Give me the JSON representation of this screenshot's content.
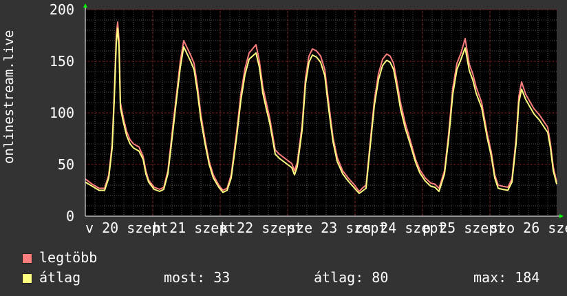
{
  "chart_data": {
    "type": "line",
    "ylabel": "onlinestream.live",
    "ylim": [
      0,
      200
    ],
    "yticks": [
      0,
      50,
      100,
      150,
      200
    ],
    "xlim": [
      0,
      685
    ],
    "xticks": [
      {
        "label": "v 20 szept",
        "x": 0
      },
      {
        "label": "h 21 szept",
        "x": 98
      },
      {
        "label": "k 22 szept",
        "x": 196
      },
      {
        "label": "sze 23 szept",
        "x": 294
      },
      {
        "label": "cs 24 szept",
        "x": 392
      },
      {
        "label": "p 25 szept",
        "x": 490
      },
      {
        "label": "szo 26 szept",
        "x": 588
      }
    ],
    "grid": true,
    "colors": {
      "background": "#333333",
      "plot": "#000000",
      "grid_major": "#8b1e1e",
      "grid_minor": "#555555",
      "axis": "#ffffff",
      "arrow": "#00ff00"
    },
    "series": [
      {
        "name": "legtöbb",
        "color": "#ff7f7f",
        "points": [
          [
            0,
            36
          ],
          [
            10,
            31
          ],
          [
            20,
            27
          ],
          [
            28,
            27
          ],
          [
            34,
            40
          ],
          [
            39,
            70
          ],
          [
            42,
            118
          ],
          [
            45,
            175
          ],
          [
            47,
            188
          ],
          [
            49,
            170
          ],
          [
            51,
            110
          ],
          [
            55,
            96
          ],
          [
            60,
            82
          ],
          [
            65,
            74
          ],
          [
            70,
            70
          ],
          [
            78,
            67
          ],
          [
            84,
            58
          ],
          [
            88,
            44
          ],
          [
            92,
            35
          ],
          [
            100,
            28
          ],
          [
            108,
            26
          ],
          [
            114,
            28
          ],
          [
            120,
            44
          ],
          [
            126,
            80
          ],
          [
            132,
            115
          ],
          [
            138,
            150
          ],
          [
            143,
            170
          ],
          [
            148,
            163
          ],
          [
            153,
            156
          ],
          [
            158,
            148
          ],
          [
            163,
            126
          ],
          [
            168,
            98
          ],
          [
            174,
            74
          ],
          [
            180,
            53
          ],
          [
            186,
            40
          ],
          [
            194,
            30
          ],
          [
            200,
            25
          ],
          [
            206,
            27
          ],
          [
            212,
            40
          ],
          [
            220,
            82
          ],
          [
            226,
            118
          ],
          [
            232,
            143
          ],
          [
            238,
            158
          ],
          [
            243,
            162
          ],
          [
            248,
            166
          ],
          [
            253,
            150
          ],
          [
            258,
            125
          ],
          [
            263,
            110
          ],
          [
            268,
            95
          ],
          [
            276,
            64
          ],
          [
            282,
            60
          ],
          [
            292,
            55
          ],
          [
            300,
            51
          ],
          [
            304,
            44
          ],
          [
            308,
            52
          ],
          [
            315,
            88
          ],
          [
            320,
            134
          ],
          [
            325,
            155
          ],
          [
            330,
            162
          ],
          [
            336,
            160
          ],
          [
            342,
            155
          ],
          [
            348,
            142
          ],
          [
            354,
            108
          ],
          [
            360,
            76
          ],
          [
            366,
            57
          ],
          [
            374,
            44
          ],
          [
            382,
            37
          ],
          [
            390,
            31
          ],
          [
            398,
            24
          ],
          [
            404,
            28
          ],
          [
            408,
            30
          ],
          [
            413,
            65
          ],
          [
            420,
            112
          ],
          [
            426,
            138
          ],
          [
            432,
            152
          ],
          [
            438,
            157
          ],
          [
            443,
            155
          ],
          [
            448,
            148
          ],
          [
            453,
            130
          ],
          [
            458,
            110
          ],
          [
            465,
            90
          ],
          [
            472,
            74
          ],
          [
            480,
            55
          ],
          [
            486,
            45
          ],
          [
            494,
            37
          ],
          [
            502,
            32
          ],
          [
            508,
            31
          ],
          [
            514,
            27
          ],
          [
            522,
            44
          ],
          [
            528,
            80
          ],
          [
            534,
            124
          ],
          [
            540,
            148
          ],
          [
            546,
            158
          ],
          [
            552,
            172
          ],
          [
            558,
            147
          ],
          [
            563,
            138
          ],
          [
            568,
            125
          ],
          [
            576,
            110
          ],
          [
            584,
            80
          ],
          [
            590,
            62
          ],
          [
            595,
            40
          ],
          [
            600,
            30
          ],
          [
            606,
            29
          ],
          [
            614,
            28
          ],
          [
            620,
            36
          ],
          [
            626,
            75
          ],
          [
            630,
            116
          ],
          [
            634,
            130
          ],
          [
            640,
            118
          ],
          [
            646,
            111
          ],
          [
            652,
            104
          ],
          [
            660,
            98
          ],
          [
            666,
            92
          ],
          [
            672,
            86
          ],
          [
            676,
            70
          ],
          [
            680,
            48
          ],
          [
            685,
            33
          ]
        ]
      },
      {
        "name": "átlag",
        "color": "#ffff80",
        "points": [
          [
            0,
            33
          ],
          [
            10,
            29
          ],
          [
            20,
            25
          ],
          [
            28,
            25
          ],
          [
            34,
            37
          ],
          [
            39,
            66
          ],
          [
            42,
            112
          ],
          [
            45,
            168
          ],
          [
            47,
            182
          ],
          [
            49,
            163
          ],
          [
            51,
            105
          ],
          [
            55,
            92
          ],
          [
            60,
            78
          ],
          [
            65,
            70
          ],
          [
            70,
            66
          ],
          [
            78,
            63
          ],
          [
            84,
            55
          ],
          [
            88,
            41
          ],
          [
            92,
            33
          ],
          [
            100,
            26
          ],
          [
            108,
            24
          ],
          [
            114,
            26
          ],
          [
            120,
            41
          ],
          [
            126,
            75
          ],
          [
            132,
            110
          ],
          [
            138,
            144
          ],
          [
            143,
            164
          ],
          [
            148,
            157
          ],
          [
            153,
            150
          ],
          [
            158,
            142
          ],
          [
            163,
            120
          ],
          [
            168,
            93
          ],
          [
            174,
            70
          ],
          [
            180,
            50
          ],
          [
            186,
            37
          ],
          [
            194,
            28
          ],
          [
            200,
            23
          ],
          [
            206,
            25
          ],
          [
            212,
            37
          ],
          [
            220,
            77
          ],
          [
            226,
            112
          ],
          [
            232,
            137
          ],
          [
            238,
            152
          ],
          [
            243,
            155
          ],
          [
            248,
            158
          ],
          [
            253,
            144
          ],
          [
            258,
            119
          ],
          [
            263,
            104
          ],
          [
            268,
            90
          ],
          [
            276,
            60
          ],
          [
            282,
            56
          ],
          [
            292,
            51
          ],
          [
            300,
            47
          ],
          [
            304,
            40
          ],
          [
            308,
            48
          ],
          [
            315,
            83
          ],
          [
            320,
            128
          ],
          [
            325,
            149
          ],
          [
            330,
            156
          ],
          [
            336,
            154
          ],
          [
            342,
            149
          ],
          [
            348,
            136
          ],
          [
            354,
            102
          ],
          [
            360,
            72
          ],
          [
            366,
            53
          ],
          [
            374,
            41
          ],
          [
            382,
            34
          ],
          [
            390,
            28
          ],
          [
            398,
            22
          ],
          [
            404,
            25
          ],
          [
            408,
            27
          ],
          [
            413,
            61
          ],
          [
            420,
            107
          ],
          [
            426,
            132
          ],
          [
            432,
            146
          ],
          [
            438,
            151
          ],
          [
            443,
            149
          ],
          [
            448,
            142
          ],
          [
            453,
            124
          ],
          [
            458,
            104
          ],
          [
            465,
            85
          ],
          [
            472,
            70
          ],
          [
            480,
            52
          ],
          [
            486,
            42
          ],
          [
            494,
            34
          ],
          [
            502,
            29
          ],
          [
            508,
            28
          ],
          [
            514,
            24
          ],
          [
            522,
            41
          ],
          [
            528,
            75
          ],
          [
            534,
            118
          ],
          [
            540,
            142
          ],
          [
            546,
            152
          ],
          [
            552,
            163
          ],
          [
            558,
            141
          ],
          [
            563,
            132
          ],
          [
            568,
            119
          ],
          [
            576,
            105
          ],
          [
            584,
            76
          ],
          [
            590,
            58
          ],
          [
            595,
            37
          ],
          [
            600,
            27
          ],
          [
            606,
            26
          ],
          [
            614,
            25
          ],
          [
            620,
            33
          ],
          [
            626,
            70
          ],
          [
            630,
            110
          ],
          [
            634,
            123
          ],
          [
            640,
            113
          ],
          [
            646,
            106
          ],
          [
            652,
            99
          ],
          [
            660,
            93
          ],
          [
            666,
            87
          ],
          [
            672,
            81
          ],
          [
            676,
            66
          ],
          [
            680,
            44
          ],
          [
            685,
            31
          ]
        ]
      }
    ]
  },
  "legend": {
    "items": [
      {
        "label": "legtöbb",
        "color": "#ff7f7f"
      },
      {
        "label": "átlag",
        "color": "#ffff80"
      }
    ],
    "stats": {
      "most": "most: 33",
      "atlag": "átlag: 80",
      "max": "max: 184"
    }
  }
}
